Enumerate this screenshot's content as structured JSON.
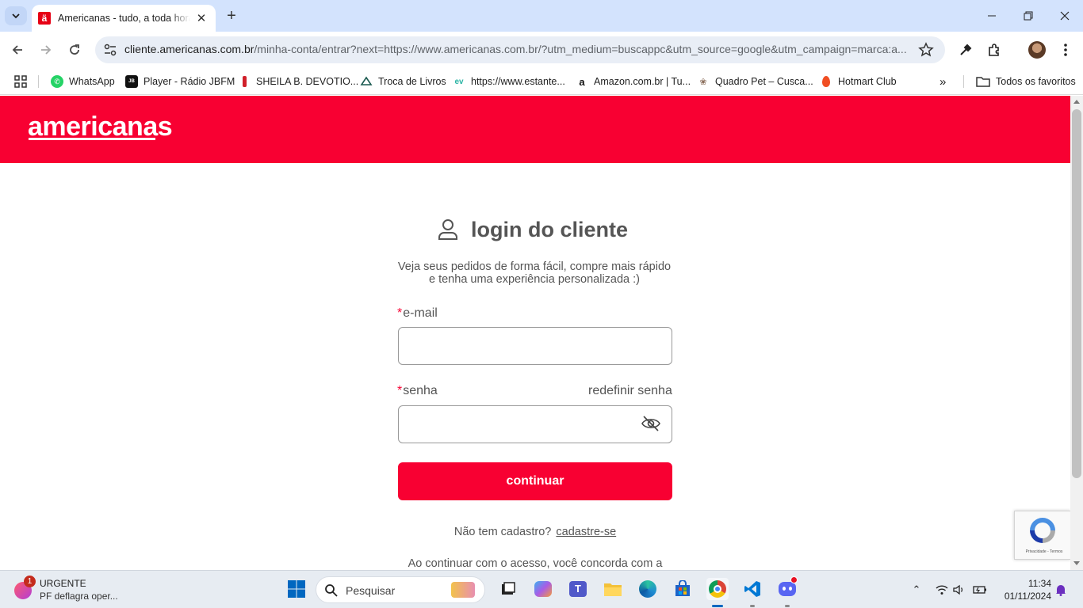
{
  "browser": {
    "tab": {
      "title": "Americanas - tudo, a toda hora",
      "favicon": "ä"
    },
    "address": {
      "host": "cliente.americanas.com.br",
      "path": "/minha-conta/entrar?next=https://www.americanas.com.br/?utm_medium=buscappc&utm_source=google&utm_campaign=marca:a..."
    },
    "bookmarks": [
      {
        "label": "WhatsApp",
        "icon": "whatsapp-icon"
      },
      {
        "label": "Player - Rádio JBFM",
        "icon": "jbfm-icon"
      },
      {
        "label": "SHEILA B. DEVOTIO...",
        "icon": "sheila-icon"
      },
      {
        "label": "Troca de Livros",
        "icon": "book-icon"
      },
      {
        "label": "https://www.estante...",
        "icon": "estante-icon"
      },
      {
        "label": "Amazon.com.br | Tu...",
        "icon": "amazon-icon"
      },
      {
        "label": "Quadro Pet – Cusca...",
        "icon": "pet-icon"
      },
      {
        "label": "Hotmart Club",
        "icon": "hotmart-icon"
      }
    ],
    "all_favorites": "Todos os favoritos"
  },
  "page": {
    "logo": "americanas",
    "title": "login do cliente",
    "subtitle_line1": "Veja seus pedidos de forma fácil, compre mais rápido",
    "subtitle_line2": "e tenha uma experiência personalizada :)",
    "email_label": "e-mail",
    "password_label": "senha",
    "required_mark": "*",
    "reset_link": "redefinir senha",
    "continue_button": "continuar",
    "signup_prompt": "Não tem cadastro?",
    "signup_link": "cadastre-se",
    "terms_text": "Ao continuar com o acesso, você concorda com a",
    "recaptcha_text": "Privacidade - Termos"
  },
  "taskbar": {
    "news_badge": "1",
    "news_title": "URGENTE",
    "news_subtitle": "PF deflagra oper...",
    "search_placeholder": "Pesquisar",
    "time": "11:34",
    "date": "01/11/2024"
  },
  "colors": {
    "brand_red": "#f80032",
    "tab_bar": "#d3e3fd"
  }
}
